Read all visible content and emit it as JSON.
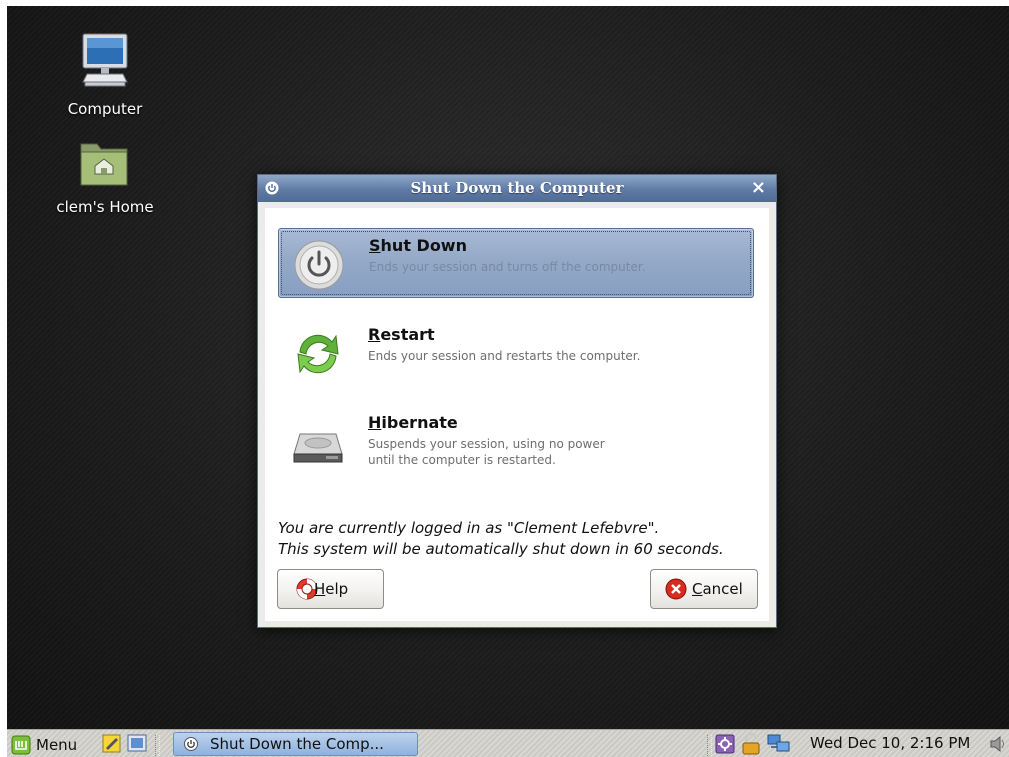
{
  "desktop": {
    "icons": [
      {
        "label": "Computer",
        "icon": "computer-icon"
      },
      {
        "label": "clem's Home",
        "icon": "home-folder-icon"
      }
    ]
  },
  "dialog": {
    "title": "Shut Down the Computer",
    "close_glyph": "×",
    "options": [
      {
        "mnemonic": "S",
        "rest": "hut Down",
        "desc_lines": [
          "Ends your session and turns off the computer."
        ],
        "icon": "power-icon",
        "selected": true
      },
      {
        "mnemonic": "R",
        "rest": "estart",
        "desc_lines": [
          "Ends your session and restarts the computer."
        ],
        "icon": "restart-icon",
        "selected": false
      },
      {
        "mnemonic": "H",
        "rest": "ibernate",
        "desc_lines": [
          "Suspends your session, using no power",
          "until the computer is restarted."
        ],
        "icon": "hard-drive-icon",
        "selected": false
      }
    ],
    "info_line1": "You are currently logged in as \"Clement Lefebvre\".",
    "info_line2": "This system will be automatically shut down in 60 seconds.",
    "help_button": {
      "mnemonic": "H",
      "rest": "elp",
      "icon": "lifebuoy-icon"
    },
    "cancel_button": {
      "mnemonic": "C",
      "rest": "ancel",
      "icon": "cancel-icon"
    }
  },
  "taskbar": {
    "menu_label": "Menu",
    "task_label": "Shut Down the Comp...",
    "clock": "Wed Dec 10,  2:16 PM",
    "colors": {
      "accent": "#5f7ba4",
      "mint_green": "#7cbf3a"
    }
  }
}
